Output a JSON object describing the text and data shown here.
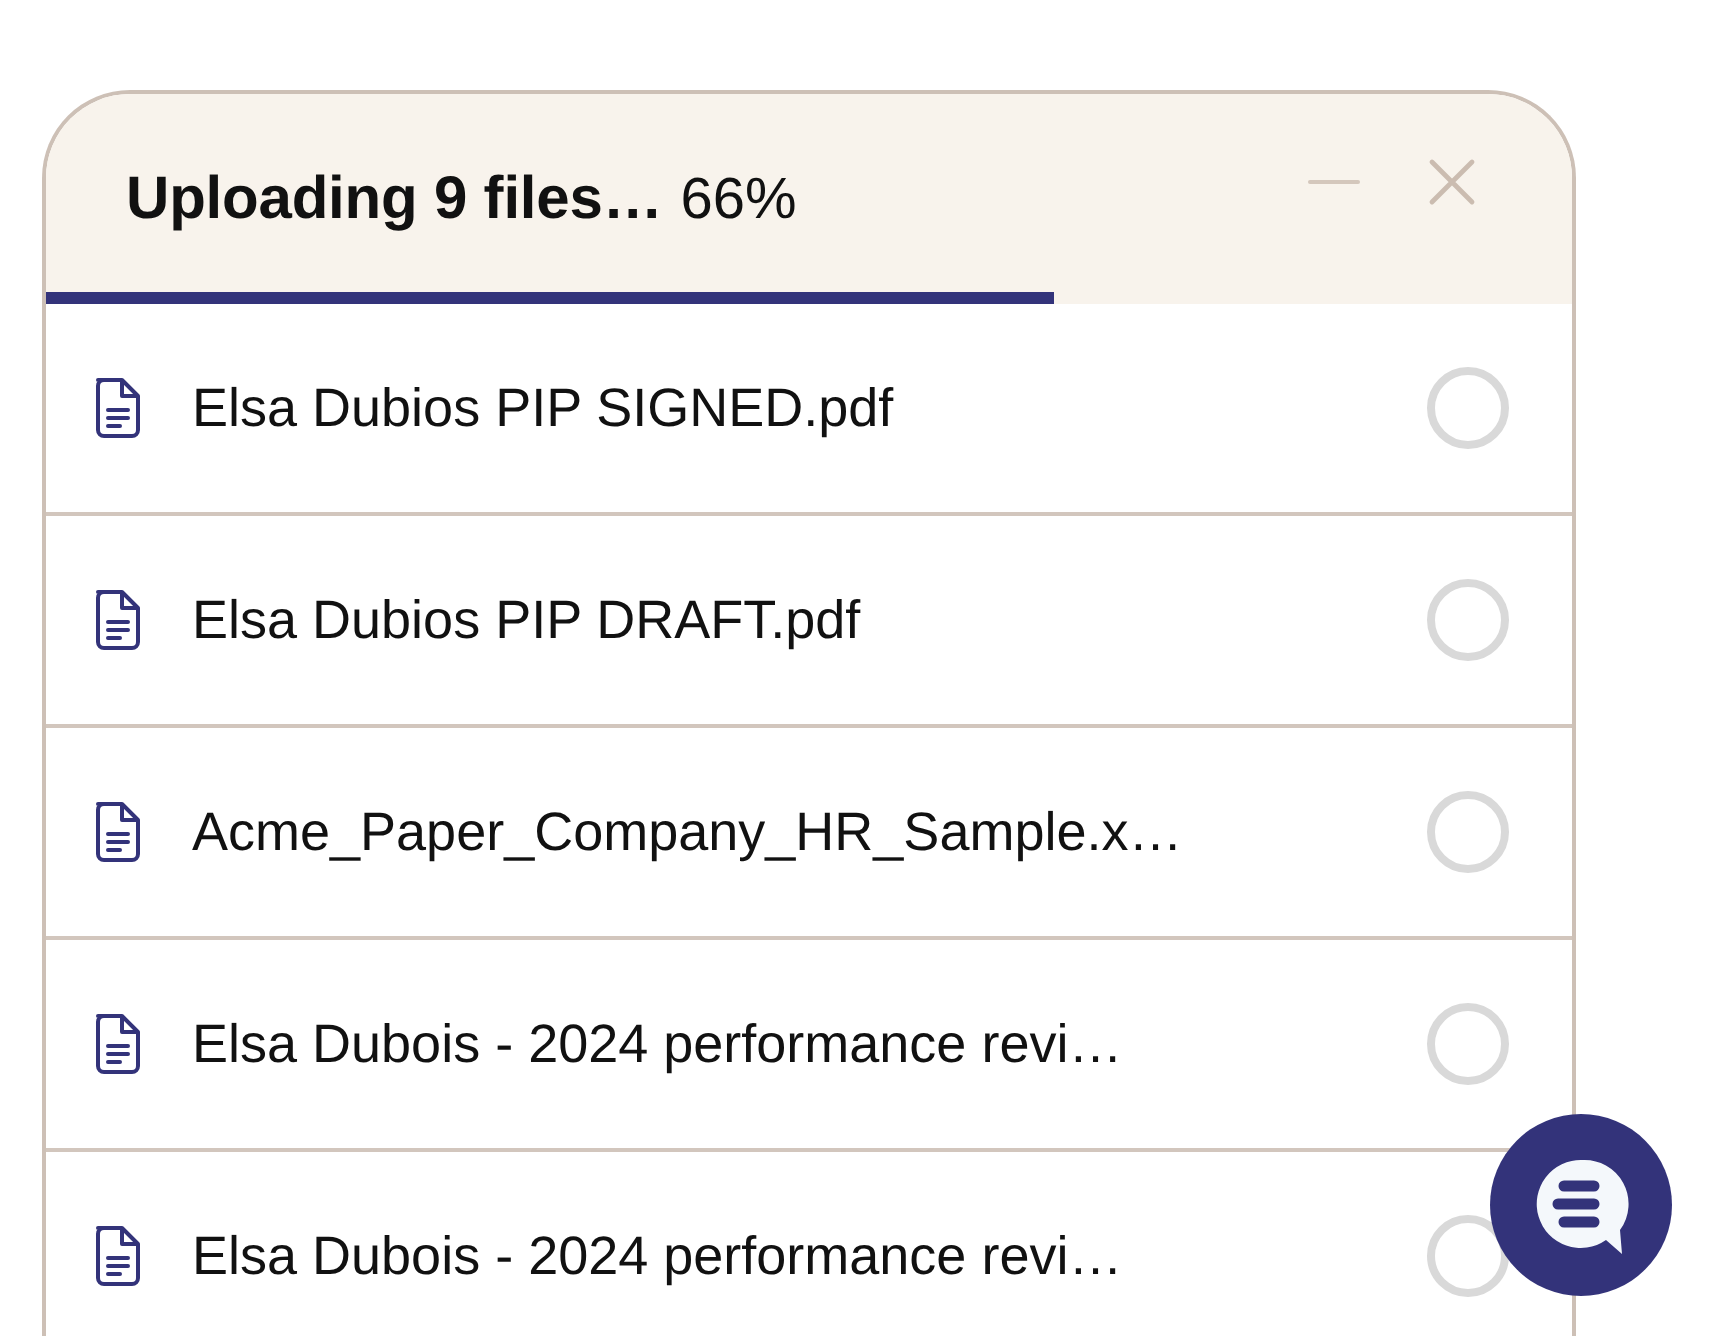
{
  "panel": {
    "title": "Uploading 9 files…",
    "percent": "66%",
    "progress": {
      "level": 0.66
    }
  },
  "files": [
    {
      "name": "Elsa Dubios PIP SIGNED.pdf",
      "complete": false
    },
    {
      "name": "Elsa Dubios PIP DRAFT.pdf",
      "complete": false
    },
    {
      "name": "Acme_Paper_Company_HR_Sample.x…",
      "complete": false
    },
    {
      "name": "Elsa Dubois - 2024 performance revi…",
      "complete": false
    },
    {
      "name": "Elsa Dubois - 2024 performance revi…",
      "complete": false
    }
  ],
  "chat_button": {
    "kind": "chat"
  }
}
